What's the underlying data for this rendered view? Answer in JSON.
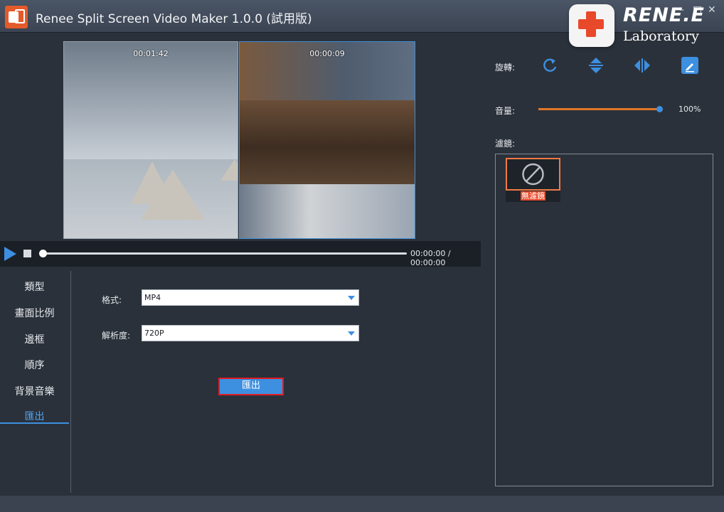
{
  "window": {
    "title": "Renee Split Screen Video Maker 1.0.0 (試用版)",
    "controls": {
      "minimize": "–",
      "maximize": "□",
      "close": "✕"
    }
  },
  "brand": {
    "name": "RENE.E",
    "sub": "Laboratory"
  },
  "preview": {
    "left_timecode": "00:01:42",
    "right_timecode": "00:00:09"
  },
  "playback": {
    "time": "00:00:00 / 00:00:00",
    "progress_fraction": 0
  },
  "nav": {
    "items": [
      {
        "label": "類型",
        "active": false
      },
      {
        "label": "畫面比例",
        "active": false
      },
      {
        "label": "邊框",
        "active": false
      },
      {
        "label": "順序",
        "active": false
      },
      {
        "label": "背景音樂",
        "active": false
      },
      {
        "label": "匯出",
        "active": true
      }
    ]
  },
  "export": {
    "format_label": "格式:",
    "format_value": "MP4",
    "resolution_label": "解析度:",
    "resolution_value": "720P",
    "button_label": "匯出"
  },
  "right": {
    "rotate_label": "旋轉:",
    "volume_label": "音量:",
    "volume_value": "100%",
    "volume_fraction": 1.0,
    "filter_label": "濾鏡:",
    "filters": [
      {
        "label": "無濾鏡",
        "selected": true
      }
    ]
  },
  "colors": {
    "accent": "#3d8fe0",
    "highlight": "#e21c24",
    "orange": "#e0762a"
  }
}
